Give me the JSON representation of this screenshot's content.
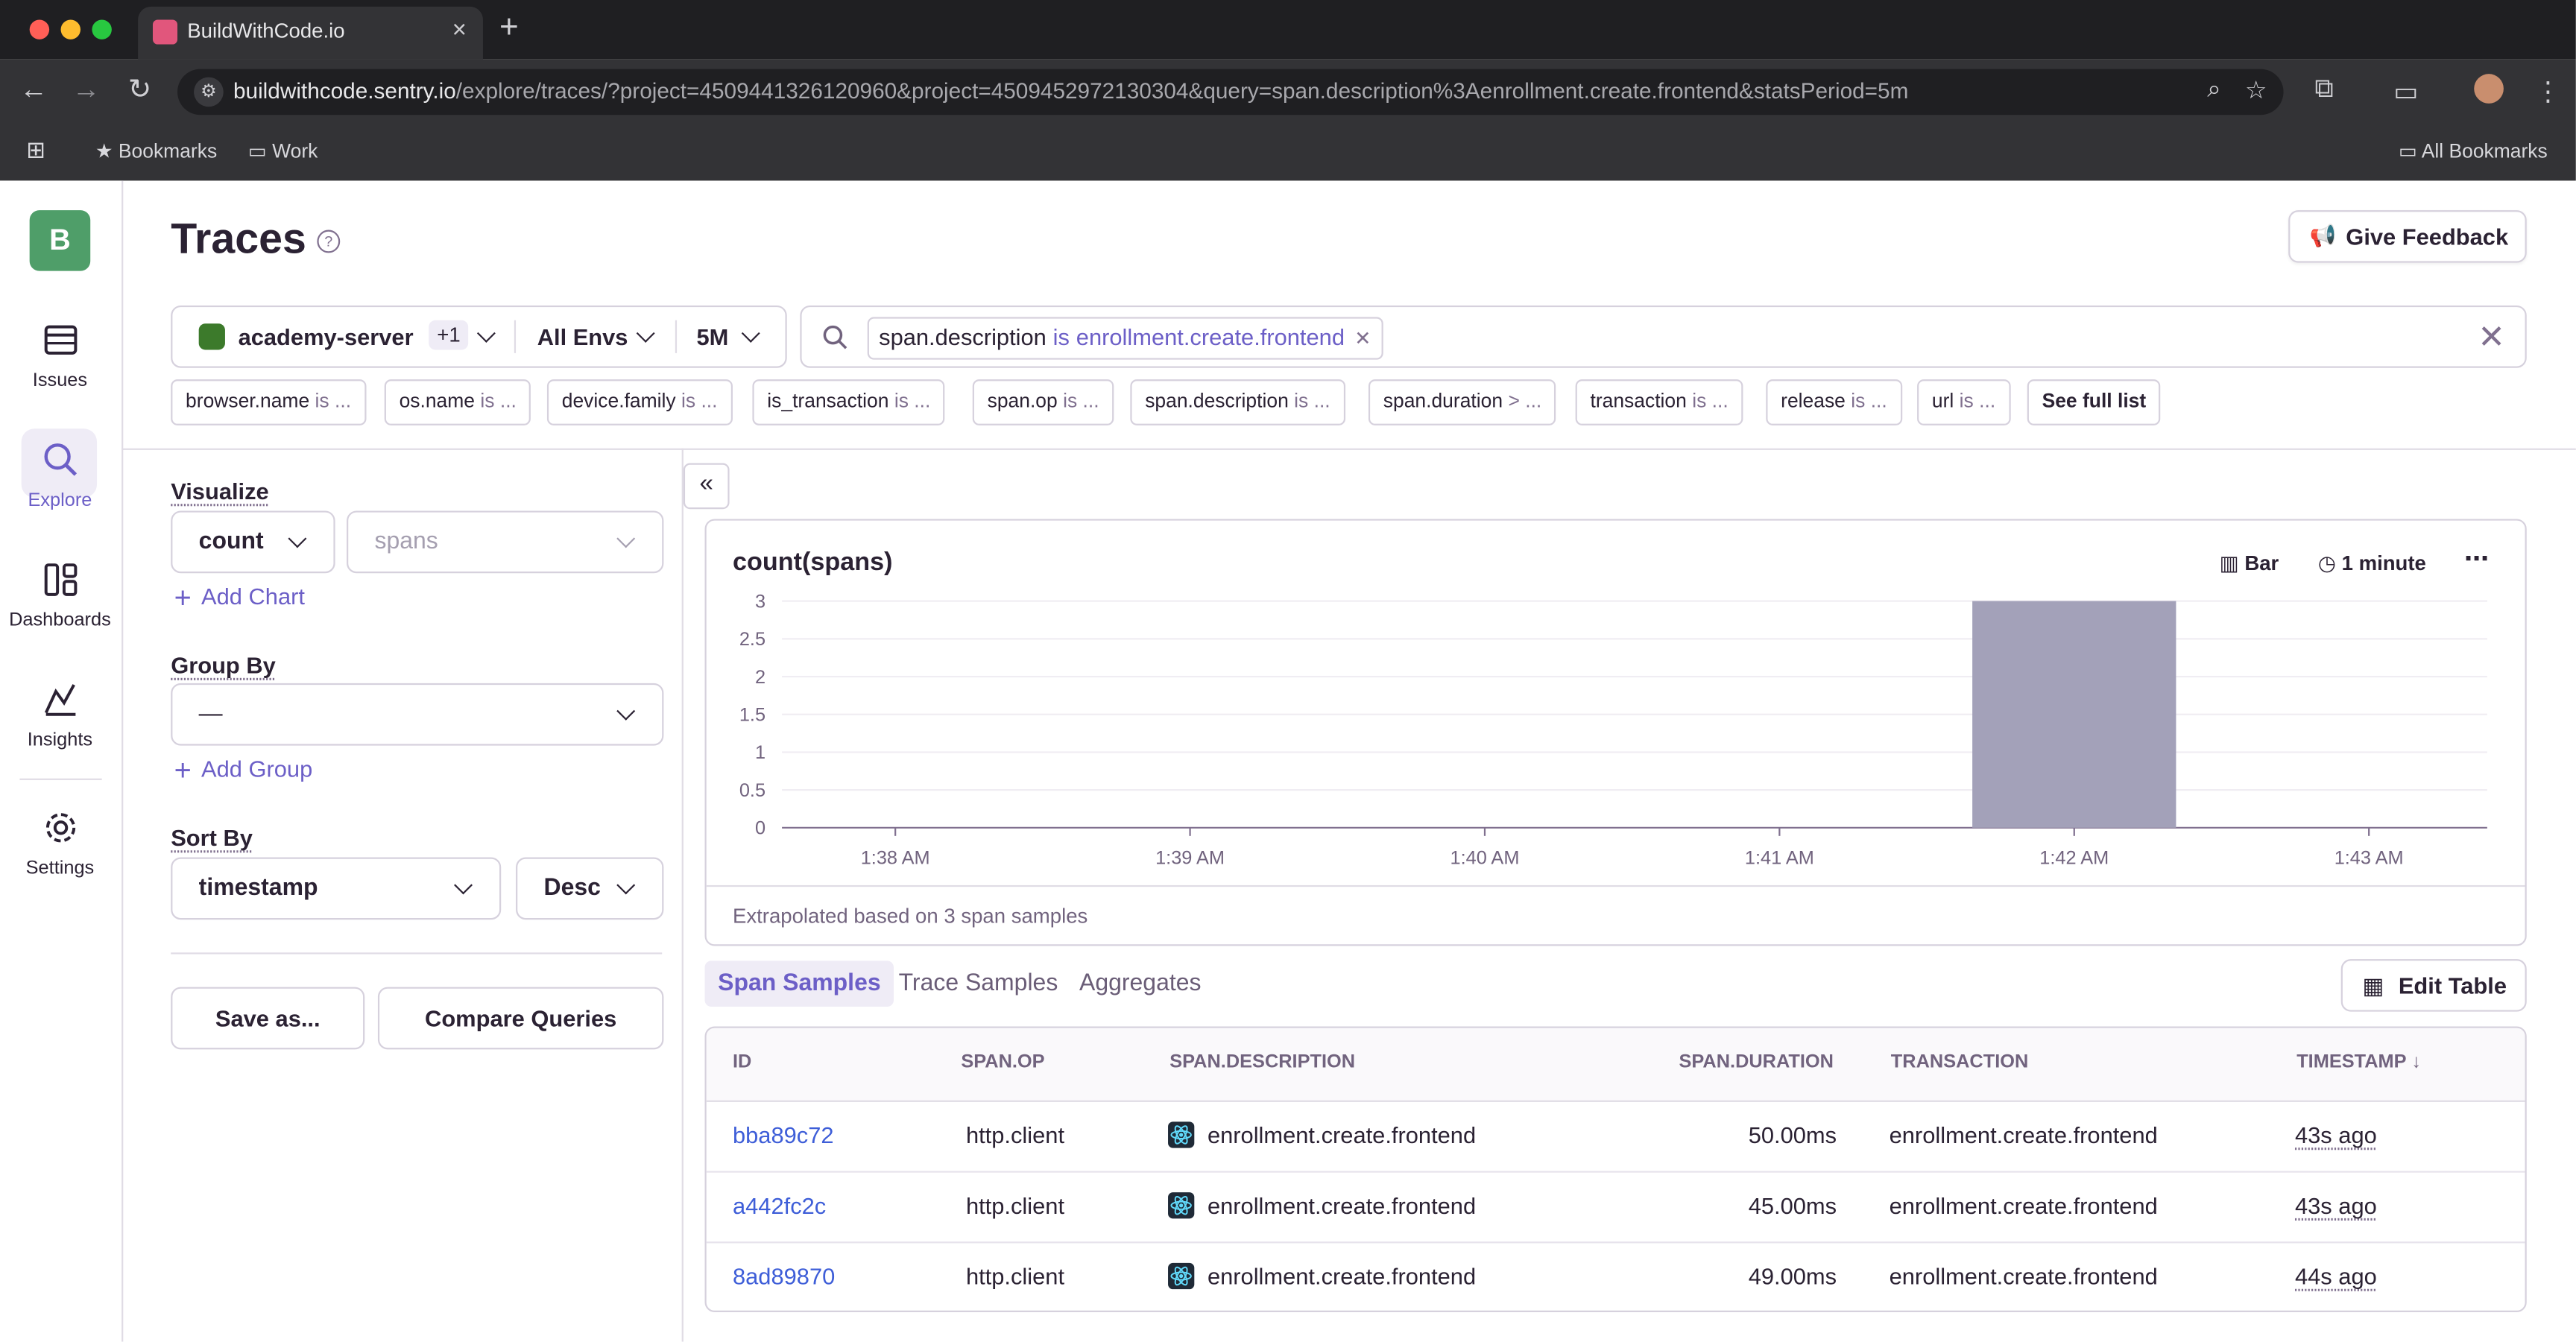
{
  "browser": {
    "tab_title": "BuildWithCode.io",
    "url_host": "buildwithcode.sentry.io",
    "url_path": "/explore/traces/?project=4509441326120960&project=4509452972130304&query=span.description%3Aenrollment.create.frontend&statsPeriod=5m",
    "bookmarks": [
      "Bookmarks",
      "Work"
    ],
    "all_bookmarks": "All Bookmarks"
  },
  "sidebar": {
    "org_initial": "B",
    "items": [
      {
        "label": "Issues",
        "icon": "issues-icon"
      },
      {
        "label": "Explore",
        "icon": "search-icon"
      },
      {
        "label": "Dashboards",
        "icon": "dashboards-icon"
      },
      {
        "label": "Insights",
        "icon": "insights-icon"
      },
      {
        "label": "Settings",
        "icon": "settings-icon"
      }
    ]
  },
  "header": {
    "title": "Traces",
    "feedback_label": "Give Feedback"
  },
  "filters": {
    "project": "academy-server",
    "project_extra": "+1",
    "environment": "All Envs",
    "period": "5M"
  },
  "search": {
    "token_key": "span.description",
    "token_op": "is",
    "token_value": "enrollment.create.frontend"
  },
  "suggestions": [
    {
      "key": "browser.name",
      "op": "is ..."
    },
    {
      "key": "os.name",
      "op": "is ..."
    },
    {
      "key": "device.family",
      "op": "is ..."
    },
    {
      "key": "is_transaction",
      "op": "is ..."
    },
    {
      "key": "span.op",
      "op": "is ..."
    },
    {
      "key": "span.description",
      "op": "is ..."
    },
    {
      "key": "span.duration",
      "op": "> ..."
    },
    {
      "key": "transaction",
      "op": "is ..."
    },
    {
      "key": "release",
      "op": "is ..."
    },
    {
      "key": "url",
      "op": "is ..."
    }
  ],
  "see_full_list": "See full list",
  "controls": {
    "visualize_label": "Visualize",
    "visualize_fn": "count",
    "visualize_field": "spans",
    "add_chart": "Add Chart",
    "group_by_label": "Group By",
    "group_by_value": "—",
    "add_group": "Add Group",
    "sort_by_label": "Sort By",
    "sort_field": "timestamp",
    "sort_dir": "Desc",
    "save_as": "Save as...",
    "compare": "Compare Queries"
  },
  "chart": {
    "type_label": "Bar",
    "interval_label": "1 minute",
    "footer": "Extrapolated based on 3 span samples"
  },
  "chart_data": {
    "type": "bar",
    "title": "count(spans)",
    "categories": [
      "1:38 AM",
      "1:39 AM",
      "1:40 AM",
      "1:41 AM",
      "1:42 AM",
      "1:43 AM"
    ],
    "values": [
      0,
      0,
      0,
      0,
      3,
      0
    ],
    "yticks": [
      "0",
      "0.5",
      "1",
      "1.5",
      "2",
      "2.5",
      "3"
    ],
    "ylim": [
      0,
      3
    ],
    "grid": true,
    "bar_color": "#a3a1b9"
  },
  "tabs": [
    "Span Samples",
    "Trace Samples",
    "Aggregates"
  ],
  "edit_table": "Edit Table",
  "table": {
    "columns": [
      "ID",
      "SPAN.OP",
      "SPAN.DESCRIPTION",
      "SPAN.DURATION",
      "TRANSACTION",
      "TIMESTAMP"
    ],
    "rows": [
      {
        "id": "bba89c72",
        "op": "http.client",
        "desc": "enrollment.create.frontend",
        "duration": "50.00ms",
        "transaction": "enrollment.create.frontend",
        "timestamp": "43s ago"
      },
      {
        "id": "a442fc2c",
        "op": "http.client",
        "desc": "enrollment.create.frontend",
        "duration": "45.00ms",
        "transaction": "enrollment.create.frontend",
        "timestamp": "43s ago"
      },
      {
        "id": "8ad89870",
        "op": "http.client",
        "desc": "enrollment.create.frontend",
        "duration": "49.00ms",
        "transaction": "enrollment.create.frontend",
        "timestamp": "44s ago"
      }
    ]
  },
  "colors": {
    "accent": "#6c5fc7",
    "link": "#3e5ed8",
    "org_badge": "#4f9e69"
  }
}
